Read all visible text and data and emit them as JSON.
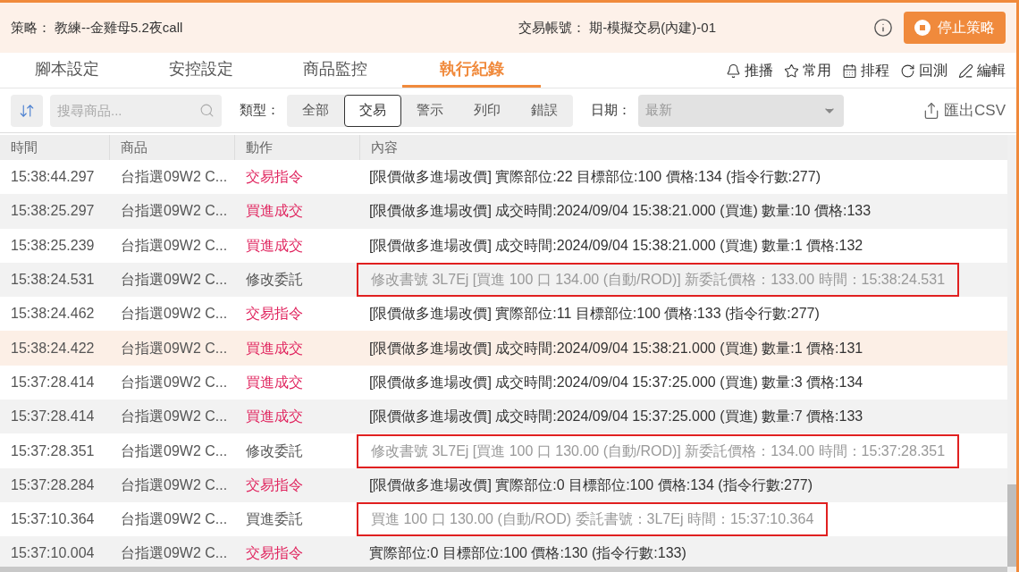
{
  "header": {
    "strategy_label": "策略：",
    "strategy": "教練--金雞母5.2夜call",
    "account_label": "交易帳號：",
    "account": "期-模擬交易(內建)-01",
    "stop_button": "停止策略"
  },
  "tabs": [
    {
      "label": "腳本設定",
      "selected": false
    },
    {
      "label": "安控設定",
      "selected": false
    },
    {
      "label": "商品監控",
      "selected": false
    },
    {
      "label": "執行紀錄",
      "selected": true
    }
  ],
  "toolbar": [
    {
      "kind": "bell",
      "label": "推播"
    },
    {
      "kind": "star",
      "label": "常用"
    },
    {
      "kind": "calendar",
      "label": "排程"
    },
    {
      "kind": "replay",
      "label": "回測"
    },
    {
      "kind": "edit",
      "label": "編輯"
    }
  ],
  "filter": {
    "search_placeholder": "搜尋商品...",
    "type_label": "類型：",
    "types": [
      {
        "label": "全部",
        "selected": false
      },
      {
        "label": "交易",
        "selected": true
      },
      {
        "label": "警示",
        "selected": false
      },
      {
        "label": "列印",
        "selected": false
      },
      {
        "label": "錯誤",
        "selected": false
      }
    ],
    "date_label": "日期：",
    "date_value": "最新",
    "export": "匯出CSV"
  },
  "table": {
    "columns": [
      "時間",
      "商品",
      "動作",
      "內容"
    ],
    "rows": [
      {
        "time": "15:38:44.297",
        "product": "台指選09W2 C...",
        "action": "交易指令",
        "kind": "signal",
        "content": "[限價做多進場改價] 實際部位:22 目標部位:100 價格:134  (指令行數:277)",
        "outlined": false,
        "selected": false
      },
      {
        "time": "15:38:25.297",
        "product": "台指選09W2 C...",
        "action": "買進成交",
        "kind": "fill",
        "content": "[限價做多進場改價] 成交時間:2024/09/04 15:38:21.000 (買進) 數量:10 價格:133",
        "outlined": false,
        "selected": false
      },
      {
        "time": "15:38:25.239",
        "product": "台指選09W2 C...",
        "action": "買進成交",
        "kind": "fill",
        "content": "[限價做多進場改價] 成交時間:2024/09/04 15:38:21.000 (買進) 數量:1 價格:132",
        "outlined": false,
        "selected": false
      },
      {
        "time": "15:38:24.531",
        "product": "台指選09W2 C...",
        "action": "修改委託",
        "kind": "order",
        "content": "修改書號 3L7Ej [買進 100 口 134.00 (自動/ROD)] 新委託價格：133.00 時間：15:38:24.531",
        "outlined": true,
        "selected": false
      },
      {
        "time": "15:38:24.462",
        "product": "台指選09W2 C...",
        "action": "交易指令",
        "kind": "signal",
        "content": "[限價做多進場改價] 實際部位:11 目標部位:100 價格:133  (指令行數:277)",
        "outlined": false,
        "selected": false
      },
      {
        "time": "15:38:24.422",
        "product": "台指選09W2 C...",
        "action": "買進成交",
        "kind": "fill",
        "content": "[限價做多進場改價] 成交時間:2024/09/04 15:38:21.000 (買進) 數量:1 價格:131",
        "outlined": false,
        "selected": true
      },
      {
        "time": "15:37:28.414",
        "product": "台指選09W2 C...",
        "action": "買進成交",
        "kind": "fill",
        "content": "[限價做多進場改價] 成交時間:2024/09/04 15:37:25.000 (買進) 數量:3 價格:134",
        "outlined": false,
        "selected": false
      },
      {
        "time": "15:37:28.414",
        "product": "台指選09W2 C...",
        "action": "買進成交",
        "kind": "fill",
        "content": "[限價做多進場改價] 成交時間:2024/09/04 15:37:25.000 (買進) 數量:7 價格:133",
        "outlined": false,
        "selected": false
      },
      {
        "time": "15:37:28.351",
        "product": "台指選09W2 C...",
        "action": "修改委託",
        "kind": "order",
        "content": "修改書號 3L7Ej [買進 100 口 130.00 (自動/ROD)] 新委託價格：134.00 時間：15:37:28.351",
        "outlined": true,
        "selected": false
      },
      {
        "time": "15:37:28.284",
        "product": "台指選09W2 C...",
        "action": "交易指令",
        "kind": "signal",
        "content": "[限價做多進場改價] 實際部位:0 目標部位:100 價格:134  (指令行數:277)",
        "outlined": false,
        "selected": false
      },
      {
        "time": "15:37:10.364",
        "product": "台指選09W2 C...",
        "action": "買進委託",
        "kind": "order",
        "content": "買進 100 口 130.00 (自動/ROD) 委託書號：3L7Ej 時間：15:37:10.364",
        "outlined": true,
        "selected": false
      },
      {
        "time": "15:37:10.004",
        "product": "台指選09W2 C...",
        "action": "交易指令",
        "kind": "signal",
        "content": "實際部位:0 目標部位:100 價格:130  (指令行數:133)",
        "outlined": false,
        "selected": false
      }
    ]
  }
}
